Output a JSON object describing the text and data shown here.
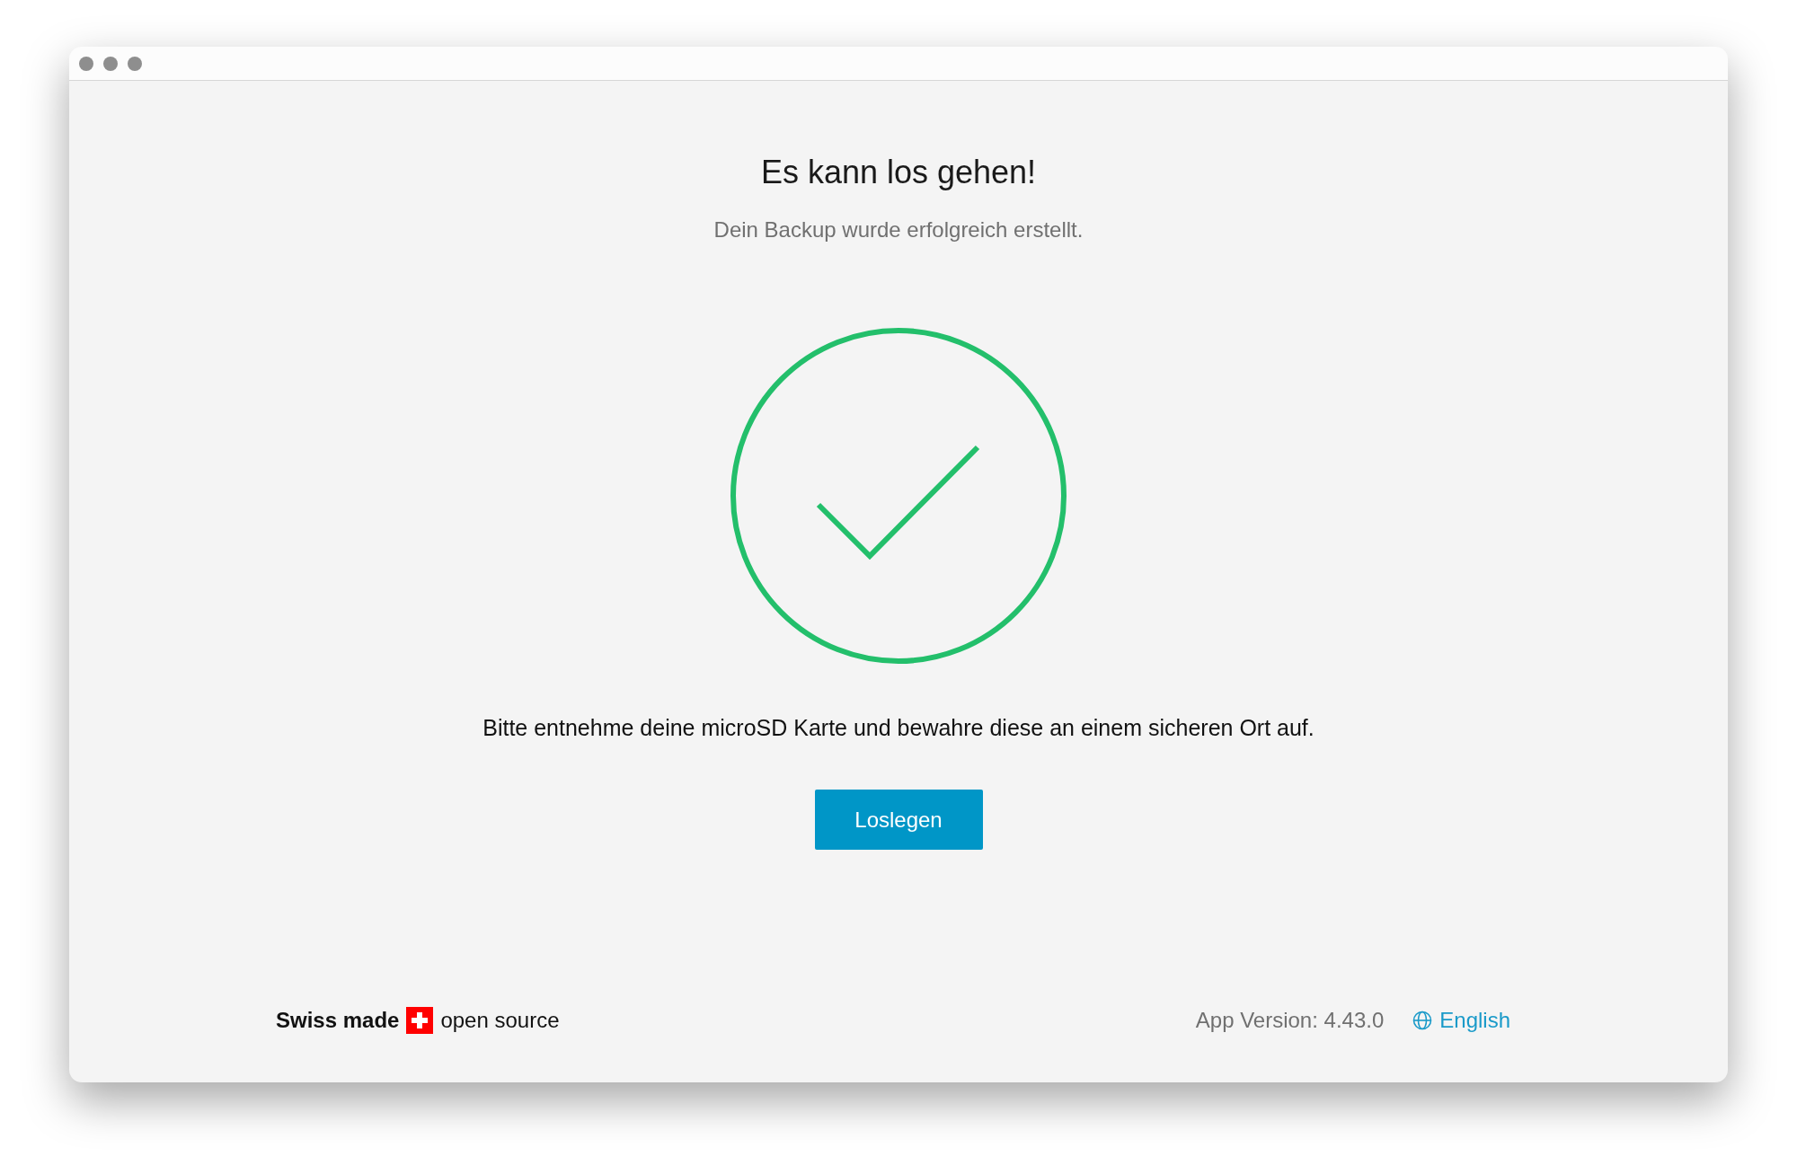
{
  "title": "Es kann los gehen!",
  "subtitle": "Dein Backup wurde erfolgreich erstellt.",
  "message": "Bitte entnehme deine microSD Karte und bewahre diese an einem sicheren Ort auf.",
  "primary_button": "Loslegen",
  "footer": {
    "brand_bold": "Swiss made",
    "brand_rest": "open source",
    "version": "App Version: 4.43.0",
    "language": "English"
  }
}
